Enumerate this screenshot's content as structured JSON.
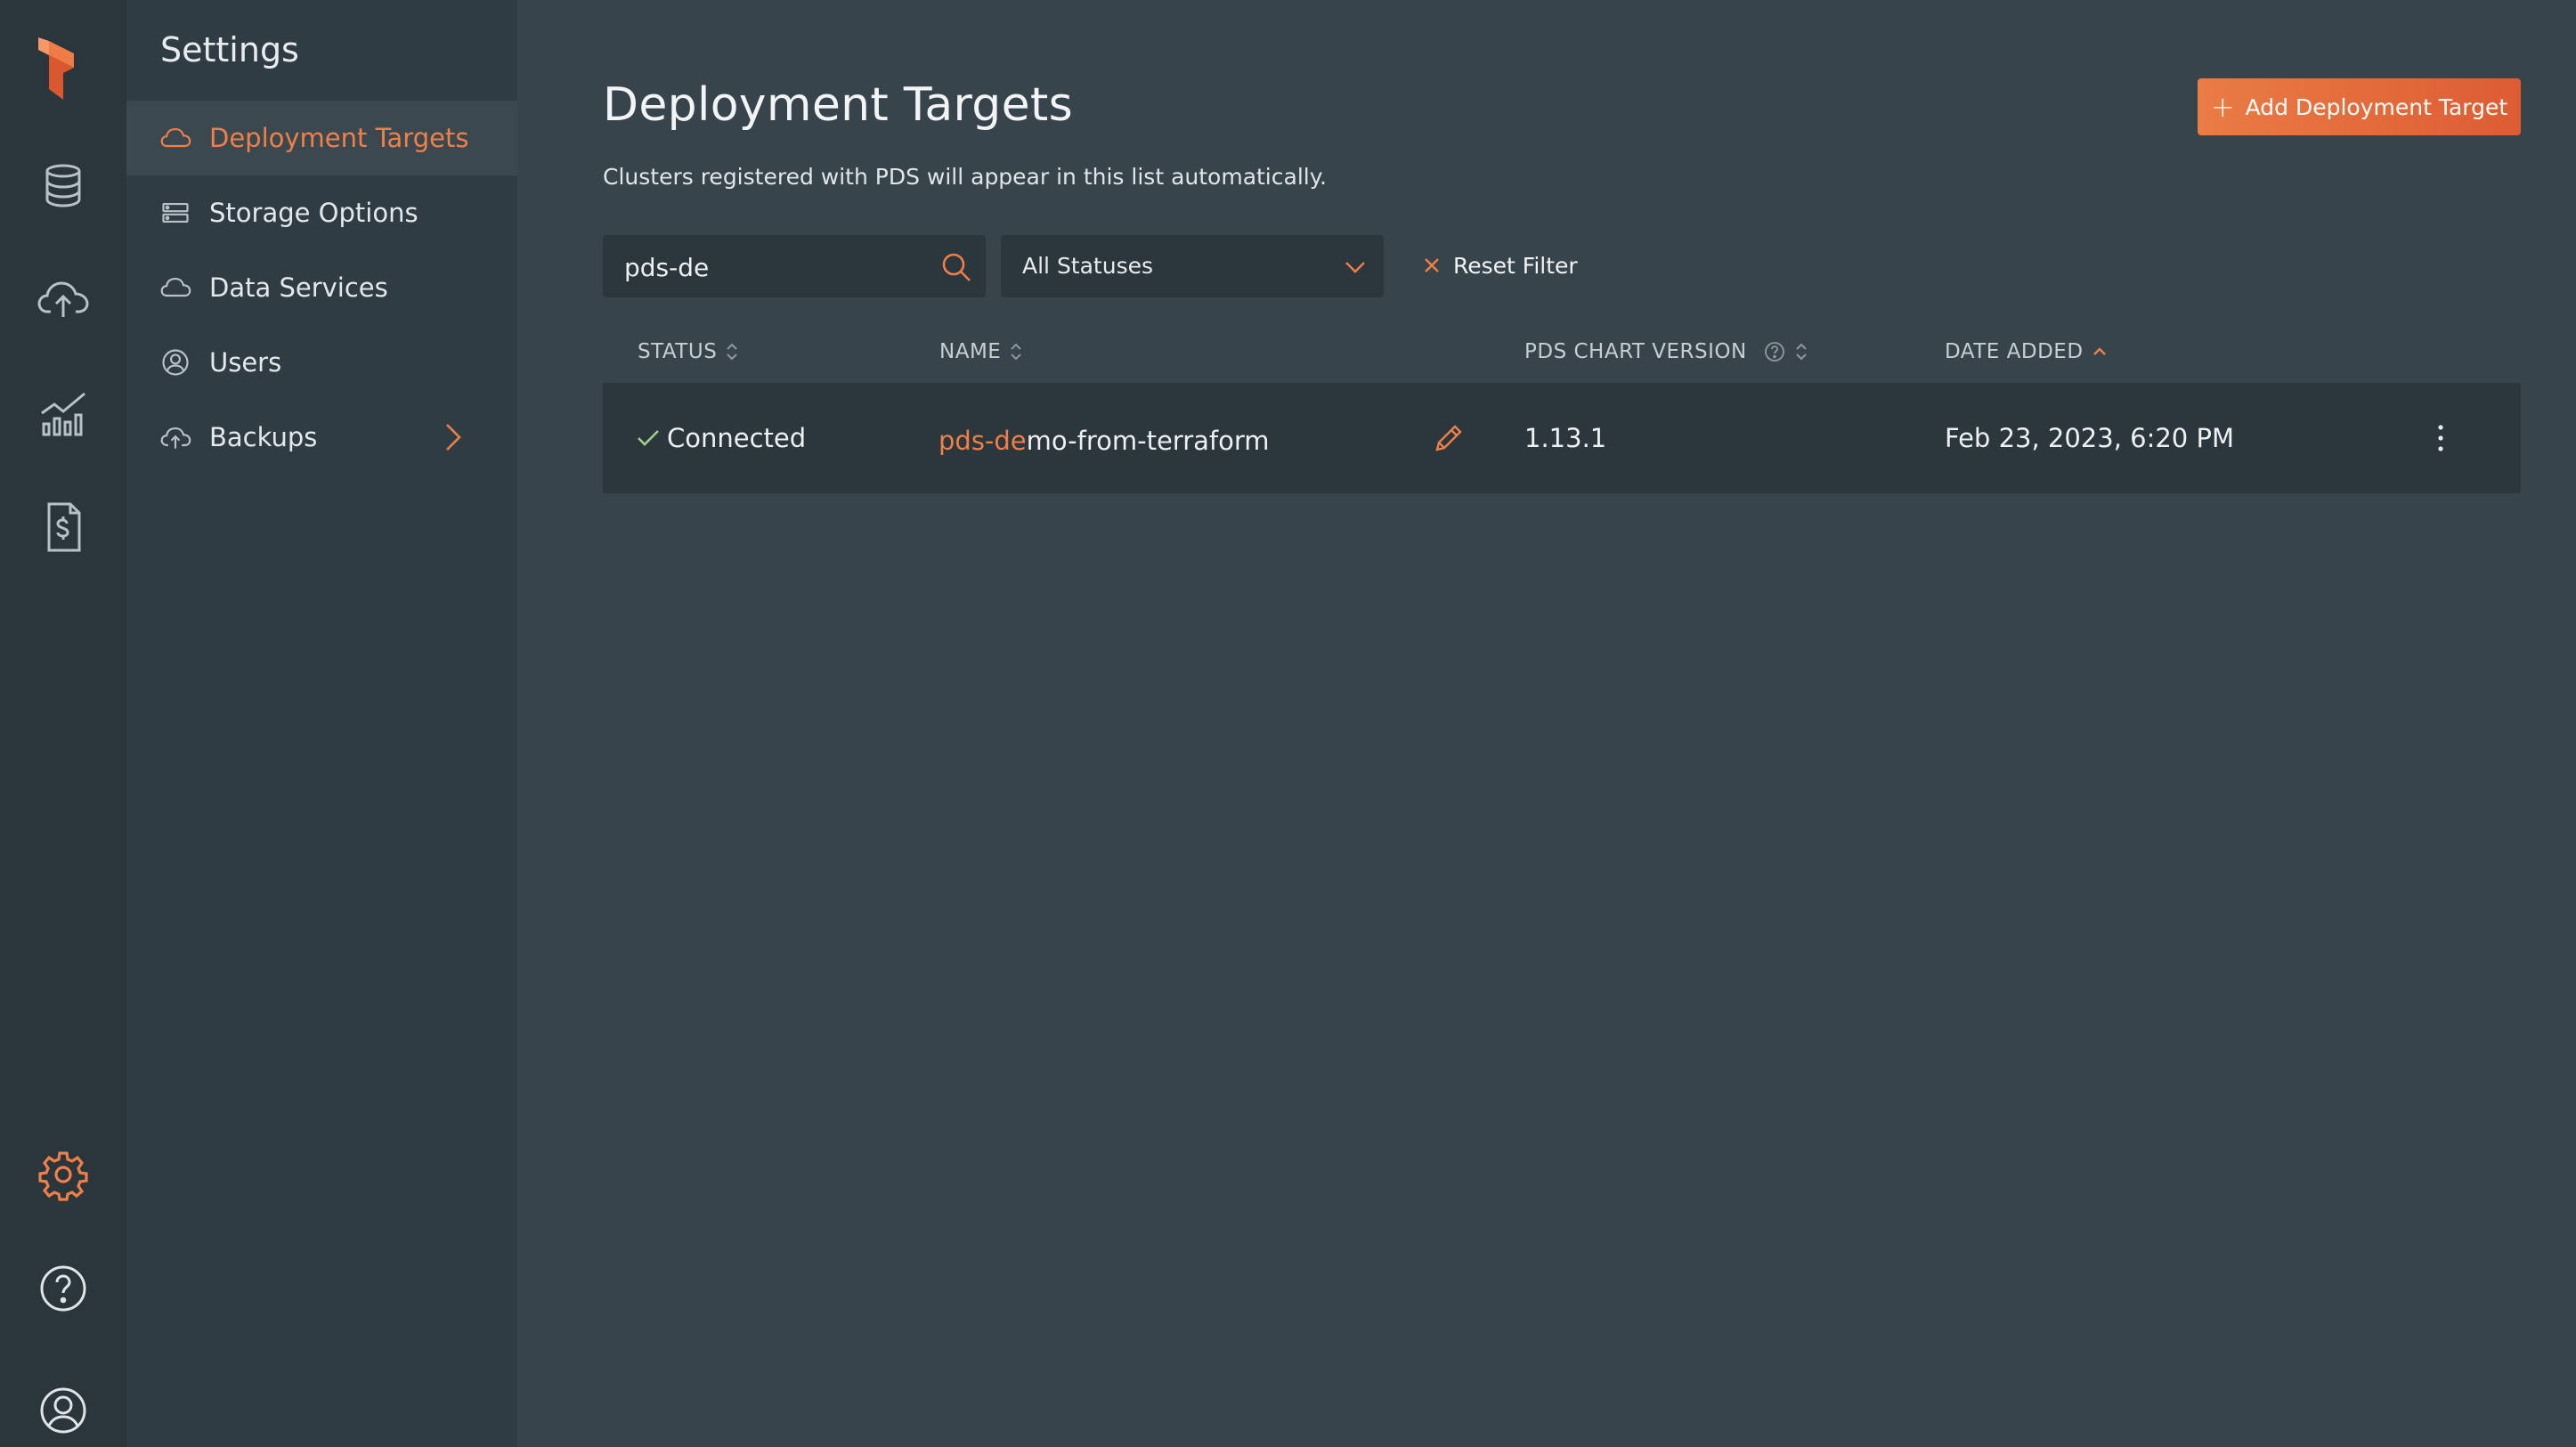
{
  "rail": {
    "icons": [
      "logo-icon",
      "database-icon",
      "cloud-upload-icon",
      "analytics-icon",
      "billing-icon",
      "settings-icon",
      "help-icon",
      "account-icon"
    ]
  },
  "sidebar": {
    "title": "Settings",
    "items": [
      {
        "label": "Deployment Targets",
        "icon": "cloud-icon",
        "active": true
      },
      {
        "label": "Storage Options",
        "icon": "storage-icon",
        "active": false
      },
      {
        "label": "Data Services",
        "icon": "cloud-icon",
        "active": false
      },
      {
        "label": "Users",
        "icon": "user-icon",
        "active": false
      },
      {
        "label": "Backups",
        "icon": "cloud-upload-icon",
        "active": false
      }
    ]
  },
  "page": {
    "title": "Deployment Targets",
    "subtitle": "Clusters registered with PDS will appear in this list automatically.",
    "add_button": "Add Deployment Target"
  },
  "filters": {
    "search_value": "pds-de",
    "status_select": "All Statuses",
    "reset_label": "Reset Filter"
  },
  "table": {
    "columns": [
      "STATUS",
      "NAME",
      "PDS CHART VERSION",
      "DATE ADDED"
    ],
    "rows": [
      {
        "status": "Connected",
        "name_match": "pds-de",
        "name_rest": "mo-from-terraform",
        "chart_version": "1.13.1",
        "date_added": "Feb 23, 2023, 6:20 PM"
      }
    ]
  },
  "colors": {
    "accent": "#ee8048",
    "background": "#37444c",
    "rail": "#2a353c",
    "sidebar": "#303c44",
    "row": "#2b363d"
  }
}
